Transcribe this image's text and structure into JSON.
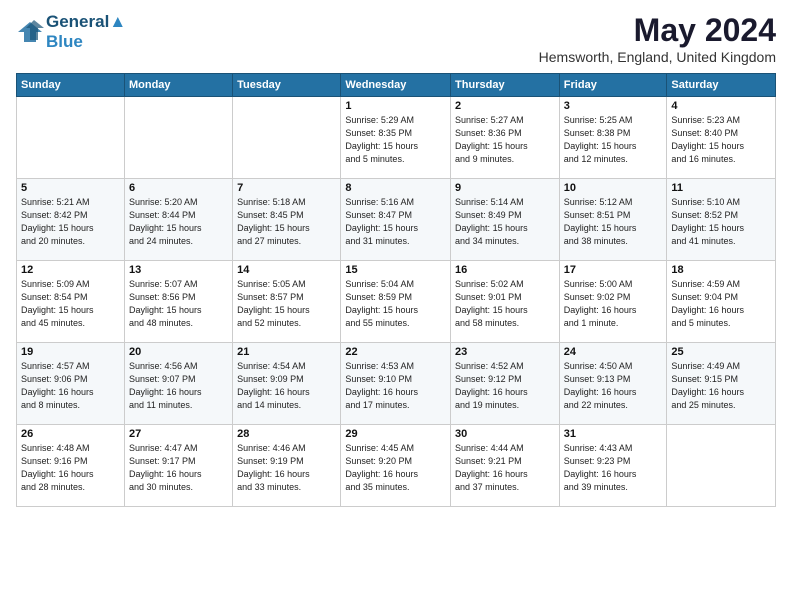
{
  "logo": {
    "line1": "General",
    "line2": "Blue"
  },
  "title": "May 2024",
  "location": "Hemsworth, England, United Kingdom",
  "days_of_week": [
    "Sunday",
    "Monday",
    "Tuesday",
    "Wednesday",
    "Thursday",
    "Friday",
    "Saturday"
  ],
  "weeks": [
    [
      {
        "day": "",
        "info": ""
      },
      {
        "day": "",
        "info": ""
      },
      {
        "day": "",
        "info": ""
      },
      {
        "day": "1",
        "info": "Sunrise: 5:29 AM\nSunset: 8:35 PM\nDaylight: 15 hours\nand 5 minutes."
      },
      {
        "day": "2",
        "info": "Sunrise: 5:27 AM\nSunset: 8:36 PM\nDaylight: 15 hours\nand 9 minutes."
      },
      {
        "day": "3",
        "info": "Sunrise: 5:25 AM\nSunset: 8:38 PM\nDaylight: 15 hours\nand 12 minutes."
      },
      {
        "day": "4",
        "info": "Sunrise: 5:23 AM\nSunset: 8:40 PM\nDaylight: 15 hours\nand 16 minutes."
      }
    ],
    [
      {
        "day": "5",
        "info": "Sunrise: 5:21 AM\nSunset: 8:42 PM\nDaylight: 15 hours\nand 20 minutes."
      },
      {
        "day": "6",
        "info": "Sunrise: 5:20 AM\nSunset: 8:44 PM\nDaylight: 15 hours\nand 24 minutes."
      },
      {
        "day": "7",
        "info": "Sunrise: 5:18 AM\nSunset: 8:45 PM\nDaylight: 15 hours\nand 27 minutes."
      },
      {
        "day": "8",
        "info": "Sunrise: 5:16 AM\nSunset: 8:47 PM\nDaylight: 15 hours\nand 31 minutes."
      },
      {
        "day": "9",
        "info": "Sunrise: 5:14 AM\nSunset: 8:49 PM\nDaylight: 15 hours\nand 34 minutes."
      },
      {
        "day": "10",
        "info": "Sunrise: 5:12 AM\nSunset: 8:51 PM\nDaylight: 15 hours\nand 38 minutes."
      },
      {
        "day": "11",
        "info": "Sunrise: 5:10 AM\nSunset: 8:52 PM\nDaylight: 15 hours\nand 41 minutes."
      }
    ],
    [
      {
        "day": "12",
        "info": "Sunrise: 5:09 AM\nSunset: 8:54 PM\nDaylight: 15 hours\nand 45 minutes."
      },
      {
        "day": "13",
        "info": "Sunrise: 5:07 AM\nSunset: 8:56 PM\nDaylight: 15 hours\nand 48 minutes."
      },
      {
        "day": "14",
        "info": "Sunrise: 5:05 AM\nSunset: 8:57 PM\nDaylight: 15 hours\nand 52 minutes."
      },
      {
        "day": "15",
        "info": "Sunrise: 5:04 AM\nSunset: 8:59 PM\nDaylight: 15 hours\nand 55 minutes."
      },
      {
        "day": "16",
        "info": "Sunrise: 5:02 AM\nSunset: 9:01 PM\nDaylight: 15 hours\nand 58 minutes."
      },
      {
        "day": "17",
        "info": "Sunrise: 5:00 AM\nSunset: 9:02 PM\nDaylight: 16 hours\nand 1 minute."
      },
      {
        "day": "18",
        "info": "Sunrise: 4:59 AM\nSunset: 9:04 PM\nDaylight: 16 hours\nand 5 minutes."
      }
    ],
    [
      {
        "day": "19",
        "info": "Sunrise: 4:57 AM\nSunset: 9:06 PM\nDaylight: 16 hours\nand 8 minutes."
      },
      {
        "day": "20",
        "info": "Sunrise: 4:56 AM\nSunset: 9:07 PM\nDaylight: 16 hours\nand 11 minutes."
      },
      {
        "day": "21",
        "info": "Sunrise: 4:54 AM\nSunset: 9:09 PM\nDaylight: 16 hours\nand 14 minutes."
      },
      {
        "day": "22",
        "info": "Sunrise: 4:53 AM\nSunset: 9:10 PM\nDaylight: 16 hours\nand 17 minutes."
      },
      {
        "day": "23",
        "info": "Sunrise: 4:52 AM\nSunset: 9:12 PM\nDaylight: 16 hours\nand 19 minutes."
      },
      {
        "day": "24",
        "info": "Sunrise: 4:50 AM\nSunset: 9:13 PM\nDaylight: 16 hours\nand 22 minutes."
      },
      {
        "day": "25",
        "info": "Sunrise: 4:49 AM\nSunset: 9:15 PM\nDaylight: 16 hours\nand 25 minutes."
      }
    ],
    [
      {
        "day": "26",
        "info": "Sunrise: 4:48 AM\nSunset: 9:16 PM\nDaylight: 16 hours\nand 28 minutes."
      },
      {
        "day": "27",
        "info": "Sunrise: 4:47 AM\nSunset: 9:17 PM\nDaylight: 16 hours\nand 30 minutes."
      },
      {
        "day": "28",
        "info": "Sunrise: 4:46 AM\nSunset: 9:19 PM\nDaylight: 16 hours\nand 33 minutes."
      },
      {
        "day": "29",
        "info": "Sunrise: 4:45 AM\nSunset: 9:20 PM\nDaylight: 16 hours\nand 35 minutes."
      },
      {
        "day": "30",
        "info": "Sunrise: 4:44 AM\nSunset: 9:21 PM\nDaylight: 16 hours\nand 37 minutes."
      },
      {
        "day": "31",
        "info": "Sunrise: 4:43 AM\nSunset: 9:23 PM\nDaylight: 16 hours\nand 39 minutes."
      },
      {
        "day": "",
        "info": ""
      }
    ]
  ]
}
